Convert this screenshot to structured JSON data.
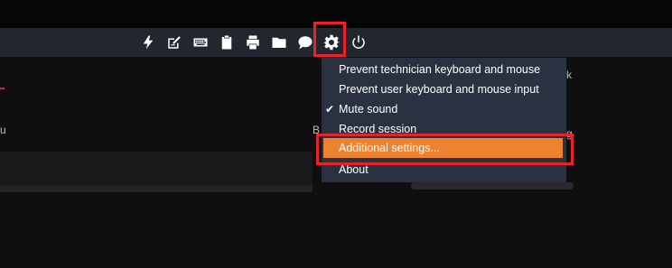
{
  "toolbar": {
    "icons": [
      "lightning-icon",
      "edit-note-icon",
      "keyboard-icon",
      "clipboard-icon",
      "printer-icon",
      "folder-icon",
      "chat-icon",
      "gear-icon",
      "power-icon"
    ]
  },
  "menu": {
    "items": [
      {
        "label": "Prevent technician keyboard and mouse",
        "checked": false
      },
      {
        "label": "Prevent user keyboard and mouse input",
        "checked": false
      },
      {
        "label": "Mute sound",
        "checked": true
      },
      {
        "label": "Record session",
        "checked": false
      },
      {
        "label": "Additional settings...",
        "checked": false,
        "highlighted": true
      },
      {
        "label": "About",
        "checked": false
      }
    ],
    "check_glyph": "✔"
  },
  "colors": {
    "toolbar_bg": "#22272f",
    "menu_bg": "#2a3140",
    "menu_active": "#ed8330",
    "annotation_red": "#e8222a"
  }
}
